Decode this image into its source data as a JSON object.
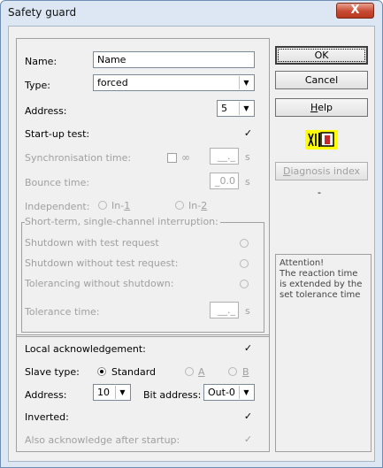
{
  "window": {
    "title": "Safety guard",
    "close_glyph": "X"
  },
  "fields": {
    "name_label": "Name:",
    "name_value": "Name",
    "type_label": "Type:",
    "type_value": "forced",
    "address_label": "Address:",
    "address_value": "5",
    "startup_label": "Start-up test:",
    "sync_label": "Synchronisation time:",
    "sync_inf": "∞",
    "sync_value": "__._",
    "sync_unit": "s",
    "bounce_label": "Bounce time:",
    "bounce_value": "_0.0",
    "bounce_unit": "s",
    "indep_label": "Independent:",
    "indep_opt1_prefix": "In-",
    "indep_opt1_key": "1",
    "indep_opt2_prefix": "In-",
    "indep_opt2_key": "2"
  },
  "shortterm": {
    "legend": "Short-term, single-channel interruption:",
    "opt1": "Shutdown with test request",
    "opt2": "Shutdown without test request:",
    "opt3": "Tolerancing without shutdown:",
    "tolerance_label": "Tolerance time:",
    "tolerance_value": "__._",
    "tolerance_unit": "s"
  },
  "ack": {
    "local_label": "Local acknowledgement:",
    "slave_type_label": "Slave type:",
    "opt_standard": "Standard",
    "opt_a": "A",
    "opt_b": "B",
    "address_label": "Address:",
    "address_value": "10",
    "bit_label": "Bit address:",
    "bit_value": "Out-0",
    "inverted_label": "Inverted:",
    "also_label": "Also acknowledge after startup:"
  },
  "buttons": {
    "ok": "OK",
    "cancel": "Cancel",
    "help_key": "H",
    "help_rest": "elp",
    "diag_key": "D",
    "diag_rest": "iagnosis index",
    "diag_value": "-"
  },
  "note": "Attention!\nThe reaction time is extended by the set tolerance time",
  "icons": {
    "guard": "safety-guard-icon"
  },
  "colors": {
    "title_bg": "#dce7f3",
    "icon_bg": "#ffff00",
    "close": "#c84a32"
  }
}
